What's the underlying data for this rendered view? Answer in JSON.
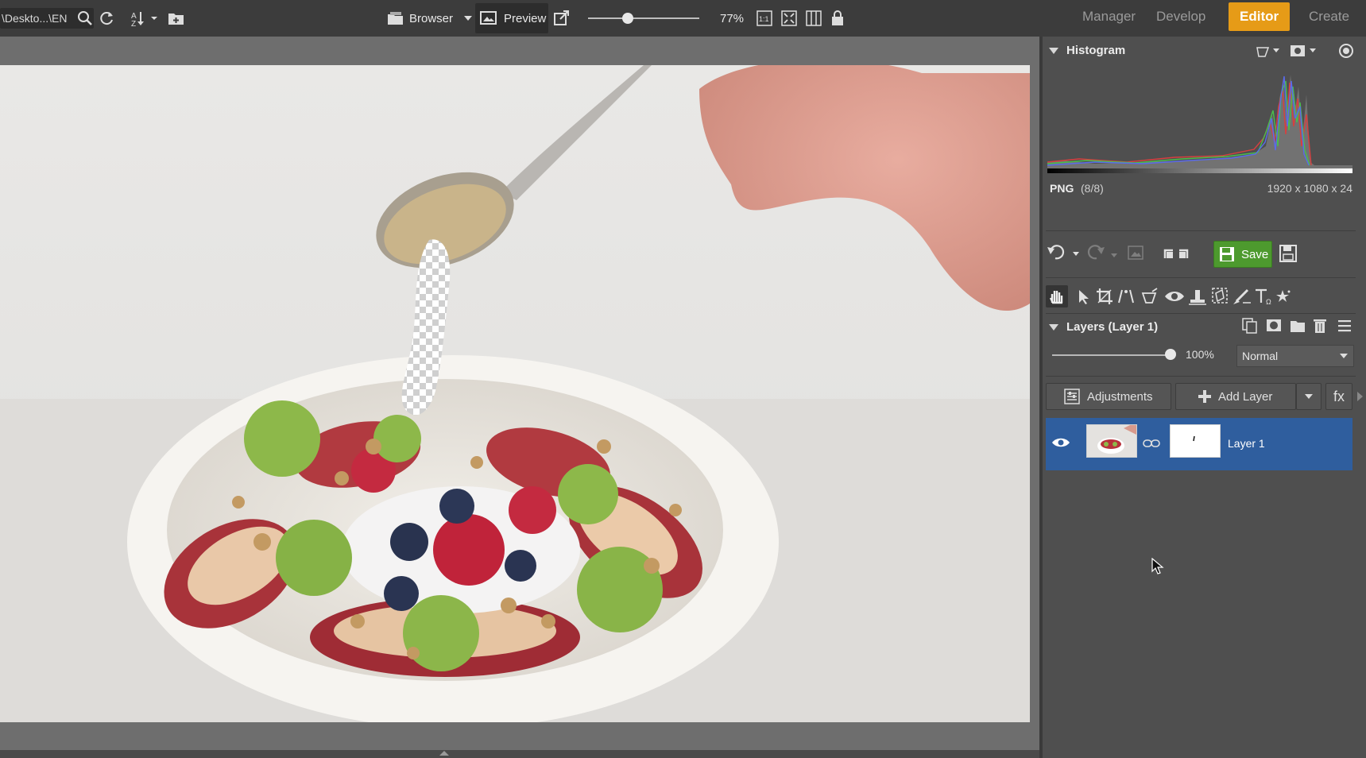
{
  "topbar": {
    "path": "\\Deskto...\\EN",
    "browser_label": "Browser",
    "preview_label": "Preview",
    "zoom": "77%",
    "zoom_slider_level": 0.36,
    "ratio_label": "1:1",
    "modes": [
      "Manager",
      "Develop",
      "Editor",
      "Create"
    ],
    "active_mode": "Editor"
  },
  "histogram": {
    "title": "Histogram",
    "format": "PNG",
    "format_detail": "(8/8)",
    "dimensions": "1920 x 1080 x 24"
  },
  "history": {
    "save_label": "Save"
  },
  "layers": {
    "title": "Layers (Layer 1)",
    "opacity": "100%",
    "opacity_level": 1.0,
    "blend_mode": "Normal",
    "adjustments_label": "Adjustments",
    "add_layer_label": "Add Layer",
    "fx_label": "fx",
    "items": [
      {
        "name": "Layer 1",
        "visible": true
      }
    ]
  },
  "colors": {
    "accent": "#e69b17",
    "selected_row": "#2f5e9e",
    "save_green": "#4d9a2e"
  }
}
